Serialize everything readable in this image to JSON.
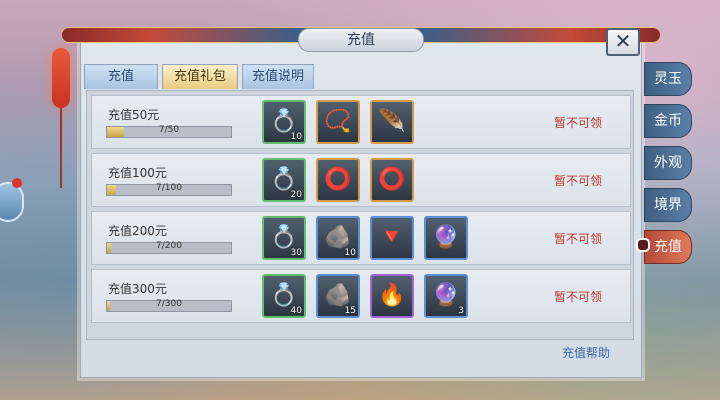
{
  "window": {
    "title": "充值",
    "close_label": "✕"
  },
  "tabs": [
    {
      "label": "充值"
    },
    {
      "label": "充值礼包"
    },
    {
      "label": "充值说明"
    }
  ],
  "rows": [
    {
      "title": "充值50元",
      "progress": "7/50",
      "status": "暂不可领",
      "items": [
        {
          "icon": "diamond-ring-icon",
          "count": "10"
        },
        {
          "icon": "amulet-icon",
          "count": ""
        },
        {
          "icon": "feather-pendant-icon",
          "count": ""
        }
      ]
    },
    {
      "title": "充值100元",
      "progress": "7/100",
      "status": "暂不可领",
      "items": [
        {
          "icon": "diamond-ring-icon",
          "count": "20"
        },
        {
          "icon": "ring-icon",
          "count": ""
        },
        {
          "icon": "ring-icon",
          "count": ""
        }
      ]
    },
    {
      "title": "充值200元",
      "progress": "7/200",
      "status": "暂不可领",
      "items": [
        {
          "icon": "diamond-ring-icon",
          "count": "30"
        },
        {
          "icon": "ore-icon",
          "count": "10"
        },
        {
          "icon": "red-crystal-icon",
          "count": ""
        },
        {
          "icon": "orb-icon",
          "count": ""
        }
      ]
    },
    {
      "title": "充值300元",
      "progress": "7/300",
      "status": "暂不可领",
      "items": [
        {
          "icon": "diamond-ring-icon",
          "count": "40"
        },
        {
          "icon": "ore-icon",
          "count": "15"
        },
        {
          "icon": "flame-crystal-icon",
          "count": ""
        },
        {
          "icon": "orb-icon",
          "count": "3"
        }
      ]
    }
  ],
  "help_link": "充值帮助",
  "side_tabs": [
    {
      "label": "灵玉"
    },
    {
      "label": "金币"
    },
    {
      "label": "外观"
    },
    {
      "label": "境界"
    },
    {
      "label": "充值"
    }
  ]
}
